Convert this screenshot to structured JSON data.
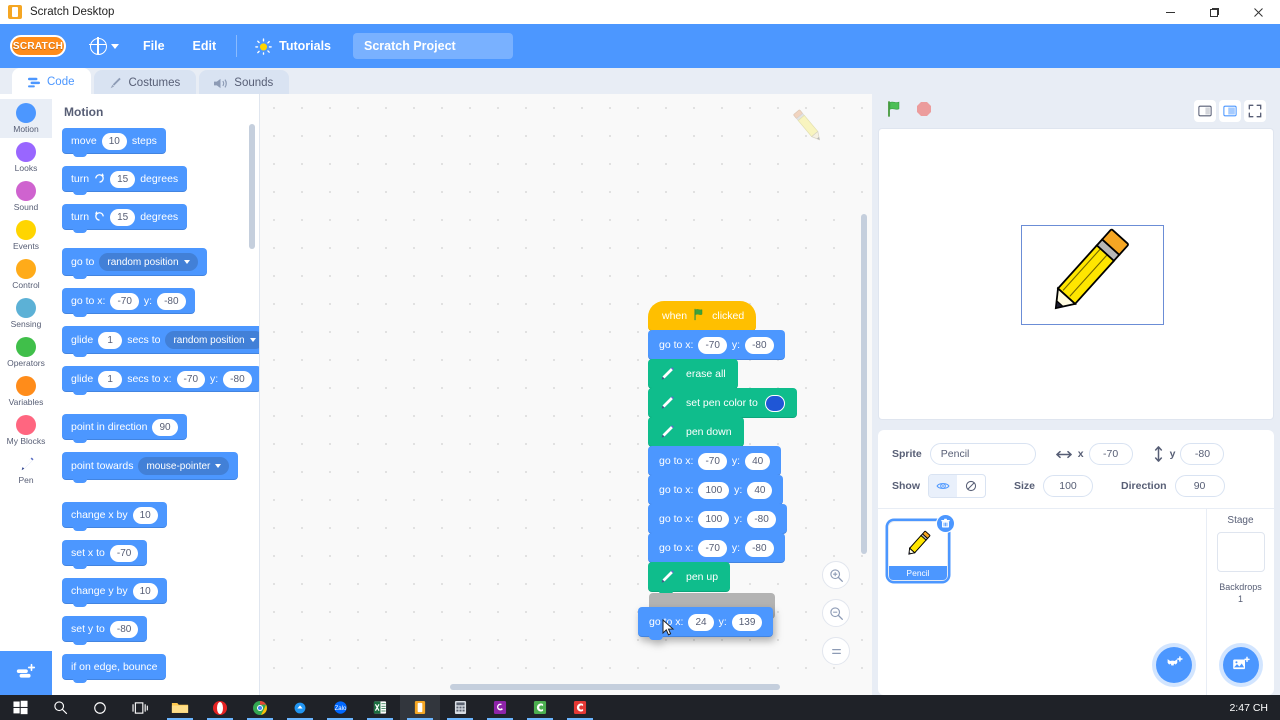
{
  "window": {
    "title": "Scratch Desktop",
    "minimize": "–",
    "maximize": "▢",
    "close": "✕"
  },
  "menubar": {
    "logo": "SCRATCH",
    "globe_icon": "globe-icon",
    "items": [
      "File",
      "Edit"
    ],
    "tutorials": "Tutorials",
    "project_name": "Scratch Project"
  },
  "tabs": [
    {
      "label": "Code",
      "icon": "code-icon",
      "active": true
    },
    {
      "label": "Costumes",
      "icon": "paintbrush-icon",
      "active": false
    },
    {
      "label": "Sounds",
      "icon": "speaker-icon",
      "active": false
    }
  ],
  "categories": [
    {
      "label": "Motion",
      "color": "#4c97ff",
      "selected": true
    },
    {
      "label": "Looks",
      "color": "#9966ff",
      "selected": false
    },
    {
      "label": "Sound",
      "color": "#cf63cf",
      "selected": false
    },
    {
      "label": "Events",
      "color": "#ffd500",
      "selected": false
    },
    {
      "label": "Control",
      "color": "#ffab19",
      "selected": false
    },
    {
      "label": "Sensing",
      "color": "#5cb1d6",
      "selected": false
    },
    {
      "label": "Operators",
      "color": "#40bf4a",
      "selected": false
    },
    {
      "label": "Variables",
      "color": "#ff8c1a",
      "selected": false
    },
    {
      "label": "My Blocks",
      "color": "#ff6680",
      "selected": false
    },
    {
      "label": "Pen",
      "color": "#0fbd8c",
      "selected": false,
      "icon": "pen-icon"
    }
  ],
  "palette": {
    "heading": "Motion",
    "blocks": [
      {
        "type": "move",
        "parts": [
          {
            "t": "text",
            "v": "move"
          },
          {
            "t": "oval",
            "v": "10"
          },
          {
            "t": "text",
            "v": "steps"
          }
        ]
      },
      {
        "type": "turn-cw",
        "parts": [
          {
            "t": "text",
            "v": "turn"
          },
          {
            "t": "icon",
            "v": "turn-right-icon"
          },
          {
            "t": "oval",
            "v": "15"
          },
          {
            "t": "text",
            "v": "degrees"
          }
        ]
      },
      {
        "type": "turn-ccw",
        "parts": [
          {
            "t": "text",
            "v": "turn"
          },
          {
            "t": "icon",
            "v": "turn-left-icon"
          },
          {
            "t": "oval",
            "v": "15"
          },
          {
            "t": "text",
            "v": "degrees"
          }
        ]
      },
      {
        "type": "goto",
        "parts": [
          {
            "t": "text",
            "v": "go to"
          },
          {
            "t": "drop",
            "v": "random position"
          }
        ]
      },
      {
        "type": "gotoxy",
        "parts": [
          {
            "t": "text",
            "v": "go to x:"
          },
          {
            "t": "oval",
            "v": "-70"
          },
          {
            "t": "text",
            "v": "y:"
          },
          {
            "t": "oval",
            "v": "-80"
          }
        ]
      },
      {
        "type": "glide-to",
        "parts": [
          {
            "t": "text",
            "v": "glide"
          },
          {
            "t": "oval",
            "v": "1"
          },
          {
            "t": "text",
            "v": "secs to"
          },
          {
            "t": "drop",
            "v": "random position"
          }
        ]
      },
      {
        "type": "glide-xy",
        "parts": [
          {
            "t": "text",
            "v": "glide"
          },
          {
            "t": "oval",
            "v": "1"
          },
          {
            "t": "text",
            "v": "secs to x:"
          },
          {
            "t": "oval",
            "v": "-70"
          },
          {
            "t": "text",
            "v": "y:"
          },
          {
            "t": "oval",
            "v": "-80"
          }
        ]
      },
      {
        "type": "point-dir",
        "parts": [
          {
            "t": "text",
            "v": "point in direction"
          },
          {
            "t": "oval",
            "v": "90"
          }
        ]
      },
      {
        "type": "point-to",
        "parts": [
          {
            "t": "text",
            "v": "point towards"
          },
          {
            "t": "drop",
            "v": "mouse-pointer"
          }
        ]
      },
      {
        "type": "change-x",
        "parts": [
          {
            "t": "text",
            "v": "change x by"
          },
          {
            "t": "oval",
            "v": "10"
          }
        ]
      },
      {
        "type": "set-x",
        "parts": [
          {
            "t": "text",
            "v": "set x to"
          },
          {
            "t": "oval",
            "v": "-70"
          }
        ]
      },
      {
        "type": "change-y",
        "parts": [
          {
            "t": "text",
            "v": "change y by"
          },
          {
            "t": "oval",
            "v": "10"
          }
        ]
      },
      {
        "type": "set-y",
        "parts": [
          {
            "t": "text",
            "v": "set y to"
          },
          {
            "t": "oval",
            "v": "-80"
          }
        ]
      },
      {
        "type": "bounce",
        "parts": [
          {
            "t": "text",
            "v": "if on edge, bounce"
          }
        ]
      }
    ]
  },
  "script": {
    "hat": {
      "pre": "when",
      "icon": "green-flag-icon",
      "post": "clicked"
    },
    "blocks": [
      {
        "kind": "motion",
        "label": "go to x:",
        "x": "-70",
        "ylabel": "y:",
        "y": "-80"
      },
      {
        "kind": "pen",
        "label": "erase all"
      },
      {
        "kind": "pen",
        "label": "set pen color to",
        "swatch": "#1f56d6"
      },
      {
        "kind": "pen",
        "label": "pen down"
      },
      {
        "kind": "motion",
        "label": "go to x:",
        "x": "-70",
        "ylabel": "y:",
        "y": "40"
      },
      {
        "kind": "motion",
        "label": "go to x:",
        "x": "100",
        "ylabel": "y:",
        "y": "40"
      },
      {
        "kind": "motion",
        "label": "go to x:",
        "x": "100",
        "ylabel": "y:",
        "y": "-80"
      },
      {
        "kind": "motion",
        "label": "go to x:",
        "x": "-70",
        "ylabel": "y:",
        "y": "-80"
      },
      {
        "kind": "pen",
        "label": "pen up"
      }
    ],
    "dragged_block": {
      "kind": "motion",
      "label": "go to x:",
      "x": "24",
      "ylabel": "y:",
      "y": "139"
    }
  },
  "workspace": {
    "zoom_in": "zoom-in-icon",
    "zoom_out": "zoom-out-icon",
    "zoom_reset": "zoom-reset-icon",
    "watermark": "pencil-watermark-icon"
  },
  "stage": {
    "green_flag": "green-flag-icon",
    "stop": "stop-icon",
    "controls": [
      "small-stage-icon",
      "large-stage-icon",
      "fullscreen-icon"
    ]
  },
  "sprite_info": {
    "sprite_label": "Sprite",
    "sprite_name": "Pencil",
    "x_label": "x",
    "x_value": "-70",
    "y_label": "y",
    "y_value": "-80",
    "show_label": "Show",
    "show_on_icon": "eye-icon",
    "show_off_icon": "eye-crossed-icon",
    "size_label": "Size",
    "size_value": "100",
    "direction_label": "Direction",
    "direction_value": "90"
  },
  "sprite_list": {
    "sprites": [
      {
        "name": "Pencil",
        "selected": true,
        "delete_icon": "trash-icon"
      }
    ],
    "add_sprite_icon": "add-sprite-cat-icon"
  },
  "stage_column": {
    "heading": "Stage",
    "backdrops_label": "Backdrops",
    "backdrops_count": "1",
    "add_backdrop_icon": "add-backdrop-icon"
  },
  "taskbar": {
    "items": [
      {
        "name": "start-button",
        "color": "#ffffff"
      },
      {
        "name": "search-icon",
        "color": "#ffffff"
      },
      {
        "name": "cortana-icon",
        "color": "#ffffff"
      },
      {
        "name": "task-view-icon",
        "color": "#ffffff"
      },
      {
        "name": "file-explorer-icon",
        "color": "#ffc107"
      },
      {
        "name": "opera-icon",
        "color": "#e52222"
      },
      {
        "name": "chrome-icon",
        "color": "#34a853"
      },
      {
        "name": "app-blue-icon",
        "color": "#2196f3"
      },
      {
        "name": "zalo-icon",
        "color": "#0068ff"
      },
      {
        "name": "excel-icon",
        "color": "#1d6f42"
      },
      {
        "name": "scratch-icon",
        "color": "#f5a623"
      },
      {
        "name": "calculator-icon",
        "color": "#d8dde3"
      },
      {
        "name": "unity-icon",
        "color": "#8e24aa"
      },
      {
        "name": "green-app-icon",
        "color": "#4caf50"
      },
      {
        "name": "red-app-icon",
        "color": "#e53935"
      }
    ],
    "clock": "2:47 CH"
  }
}
